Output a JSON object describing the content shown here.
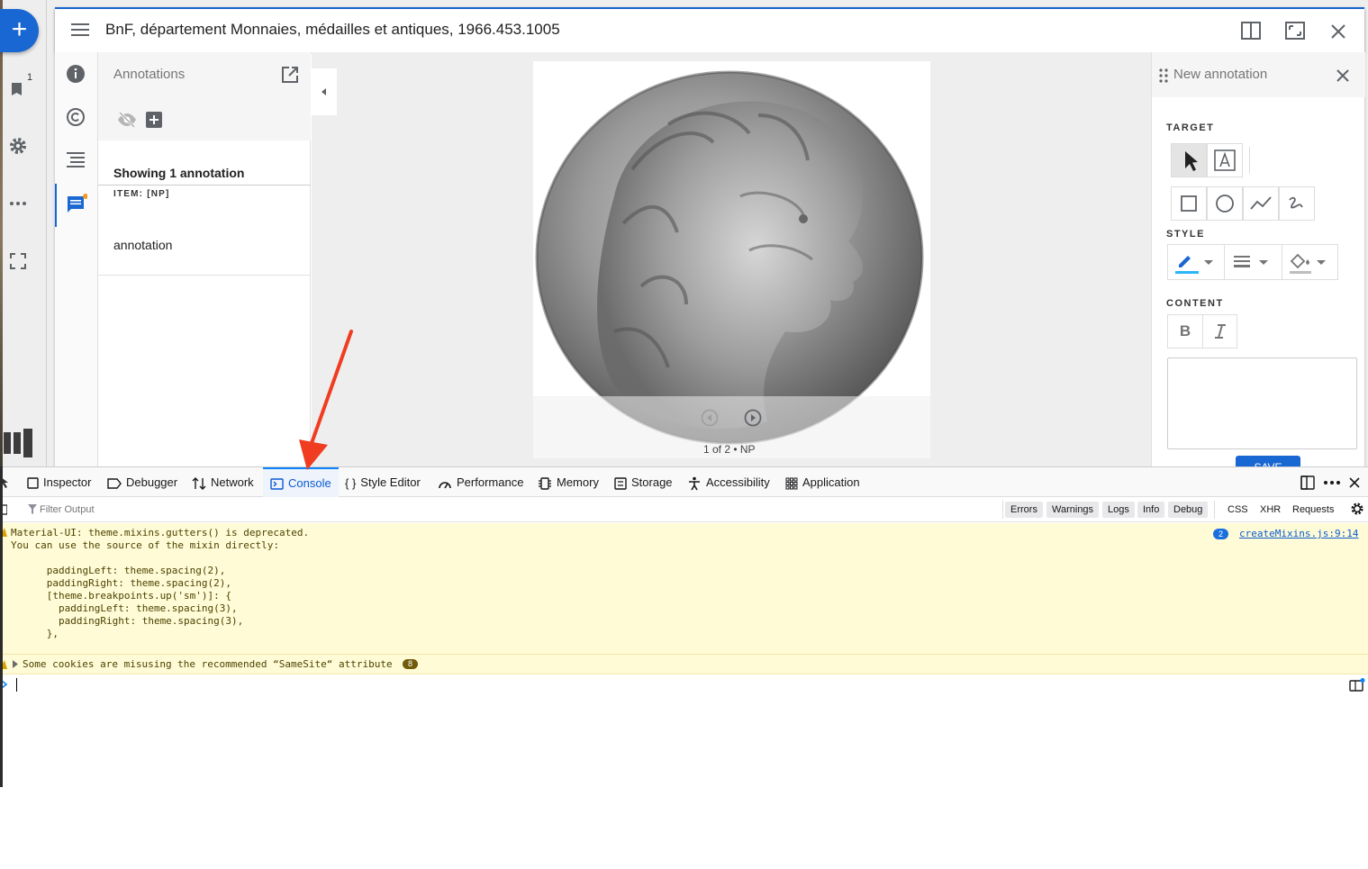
{
  "window": {
    "title": "BnF, département Monnaies, médailles et antiques, 1966.453.1005"
  },
  "workspace": {
    "window_count_badge": "1"
  },
  "annotations_panel": {
    "title": "Annotations",
    "showing_text": "Showing 1 annotation",
    "items": [
      {
        "tag": "ITEM: [NP]",
        "text": "annotation"
      }
    ]
  },
  "canvas": {
    "page_indicator": "1 of 2 • NP"
  },
  "new_annotation": {
    "title": "New annotation",
    "target_label": "TARGET",
    "style_label": "STYLE",
    "content_label": "CONTENT",
    "stroke_color": "#29b6f6",
    "save_label": "SAVE"
  },
  "devtools": {
    "tabs": [
      {
        "label": "Inspector"
      },
      {
        "label": "Debugger"
      },
      {
        "label": "Network"
      },
      {
        "label": "Console"
      },
      {
        "label": "Style Editor"
      },
      {
        "label": "Performance"
      },
      {
        "label": "Memory"
      },
      {
        "label": "Storage"
      },
      {
        "label": "Accessibility"
      },
      {
        "label": "Application"
      }
    ],
    "active_tab": "Console",
    "filter_placeholder": "Filter Output",
    "filter_buttons": [
      "Errors",
      "Warnings",
      "Logs",
      "Info",
      "Debug"
    ],
    "filter_types": [
      "CSS",
      "XHR",
      "Requests"
    ],
    "messages": [
      {
        "lines": [
          "Material-UI: theme.mixins.gutters() is deprecated.",
          "You can use the source of the mixin directly:",
          "",
          "      paddingLeft: theme.spacing(2),",
          "      paddingRight: theme.spacing(2),",
          "      [theme.breakpoints.up('sm')]: {",
          "        paddingLeft: theme.spacing(3),",
          "        paddingRight: theme.spacing(3),",
          "      },"
        ],
        "repeat_count": "2",
        "source": "createMixins.js:9:14"
      },
      {
        "text": "Some cookies are misusing the recommended “SameSite“ attribute",
        "count": "8"
      }
    ]
  },
  "colors": {
    "accent": "#1967d2",
    "devtools_accent": "#0a84ff",
    "warning_bg": "#fffbd6",
    "arrow": "#f03c20"
  }
}
